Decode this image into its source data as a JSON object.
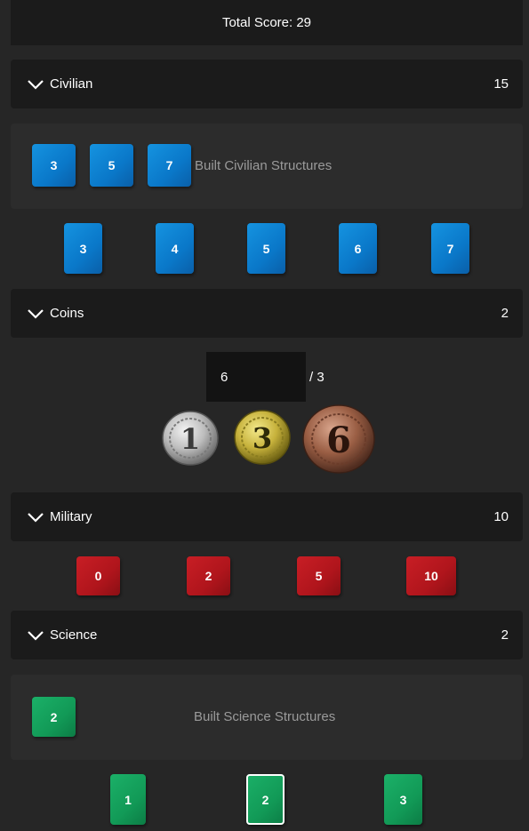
{
  "total_score": "Total Score: 29",
  "civilian": {
    "title": "Civilian",
    "score": "15",
    "built_label": "Built Civilian Structures",
    "built": [
      "3",
      "5",
      "7"
    ],
    "options": [
      "3",
      "4",
      "5",
      "6",
      "7"
    ],
    "color": "#0a78c9"
  },
  "coins": {
    "title": "Coins",
    "score": "2",
    "input_value": "6",
    "total_text": "/ 3",
    "coin_values": [
      "1",
      "3",
      "6"
    ],
    "coin_types": [
      "silver-coin",
      "gold-coin",
      "bronze-coin"
    ]
  },
  "military": {
    "title": "Military",
    "score": "10",
    "options": [
      "0",
      "2",
      "5",
      "10"
    ],
    "color": "#b0151c"
  },
  "science": {
    "title": "Science",
    "score": "2",
    "built_label": "Built Science Structures",
    "built": [
      "2"
    ],
    "options": [
      "1",
      "2",
      "3"
    ],
    "selected_option": "2",
    "color": "#129a57"
  },
  "icons": {
    "chevron": "chevron-down-icon"
  }
}
